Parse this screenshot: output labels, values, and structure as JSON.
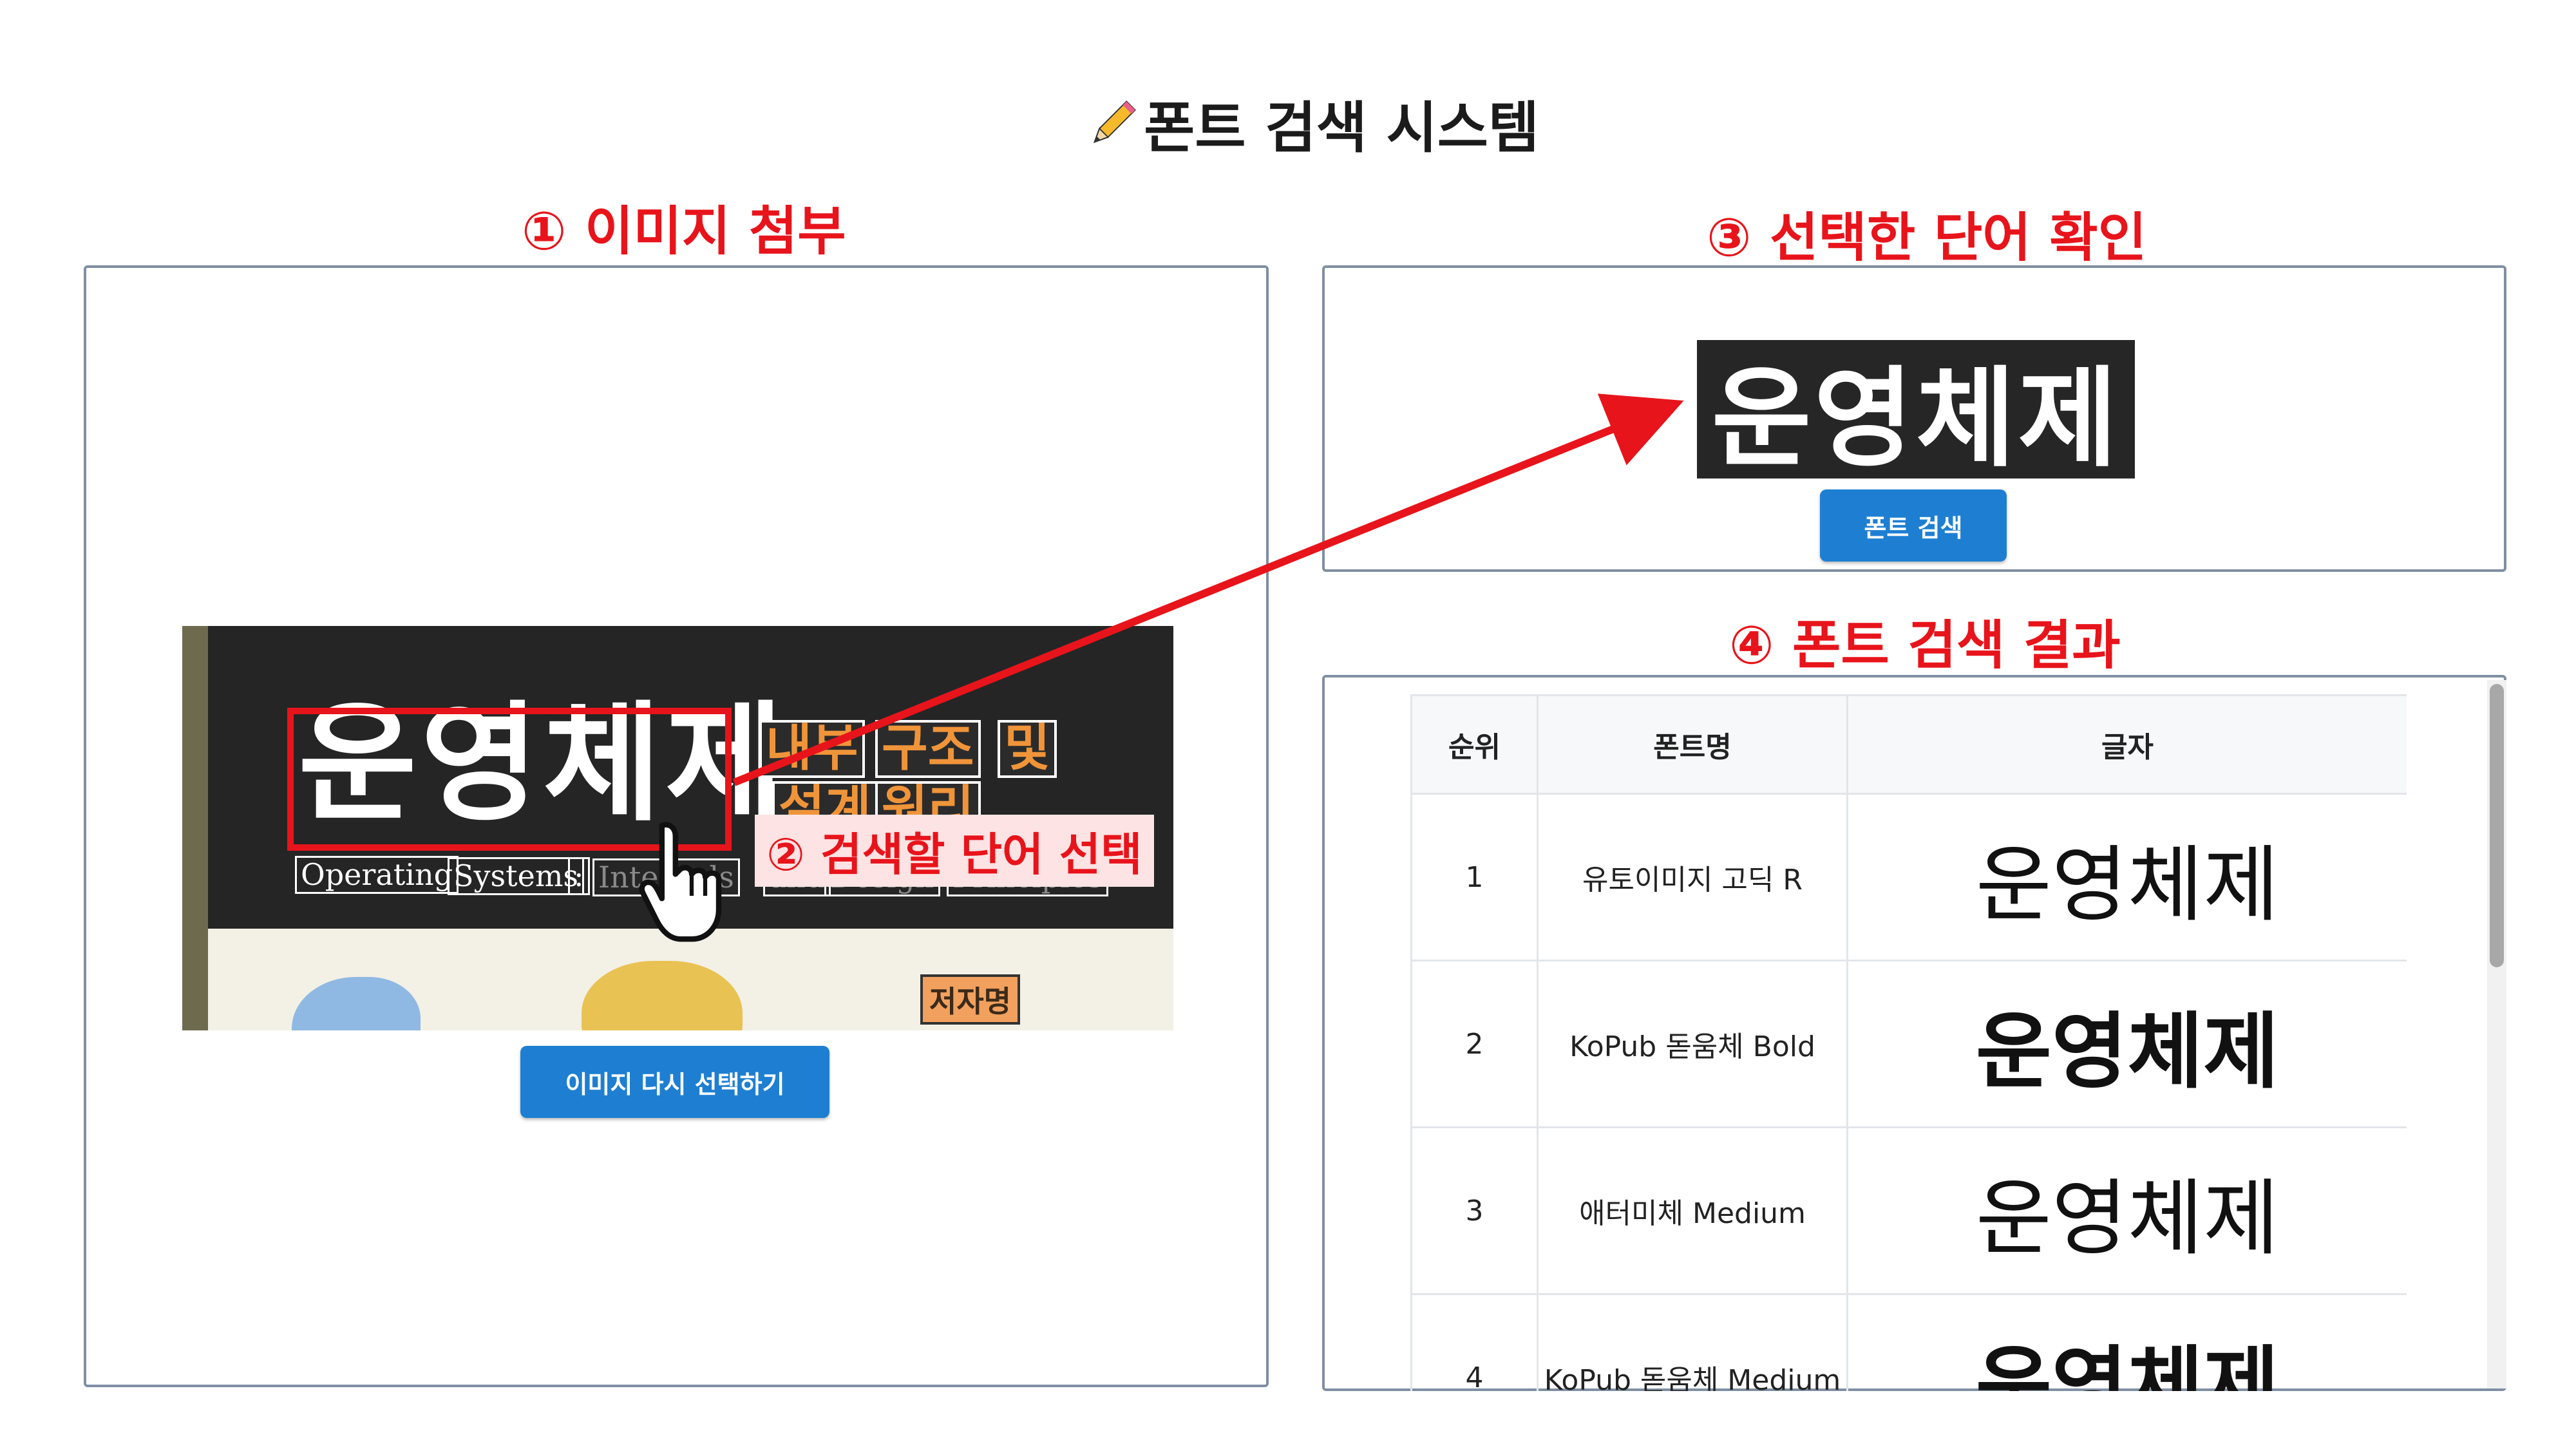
{
  "page": {
    "title": "폰트 검색 시스템",
    "title_icon": "pencil-icon"
  },
  "steps": {
    "attach": "① 이미지 첨부",
    "select": "② 검색할 단어 선택",
    "confirm": "③ 선택한 단어 확인",
    "results": "④ 폰트 검색 결과"
  },
  "photo": {
    "main_word": "운영체제",
    "orange_words": [
      "내부",
      "구조",
      "및",
      "설계",
      "원리"
    ],
    "english_words": [
      "Operating",
      "Systems",
      ":",
      "Internals",
      "and",
      "Design",
      "Principles"
    ],
    "author": "저자명",
    "cursor_icon": "hand-pointer-icon"
  },
  "buttons": {
    "reselect_image": "이미지 다시 선택하기",
    "search_font": "폰트 검색"
  },
  "selected_word": "운영체제",
  "results_table": {
    "headers": [
      "순위",
      "폰트명",
      "글자"
    ],
    "rows": [
      {
        "rank": "1",
        "font": "유토이미지 고딕 R",
        "sample": "운영체제"
      },
      {
        "rank": "2",
        "font": "KoPub 돋움체 Bold",
        "sample": "운영체제"
      },
      {
        "rank": "3",
        "font": "애터미체 Medium",
        "sample": "운영체제"
      },
      {
        "rank": "4",
        "font": "KoPub 돋움체 Medium",
        "sample": "운영체제"
      }
    ]
  },
  "colors": {
    "accent_red": "#e8141b",
    "button_blue": "#1e7fd2",
    "panel_border": "#7f8fa3"
  }
}
